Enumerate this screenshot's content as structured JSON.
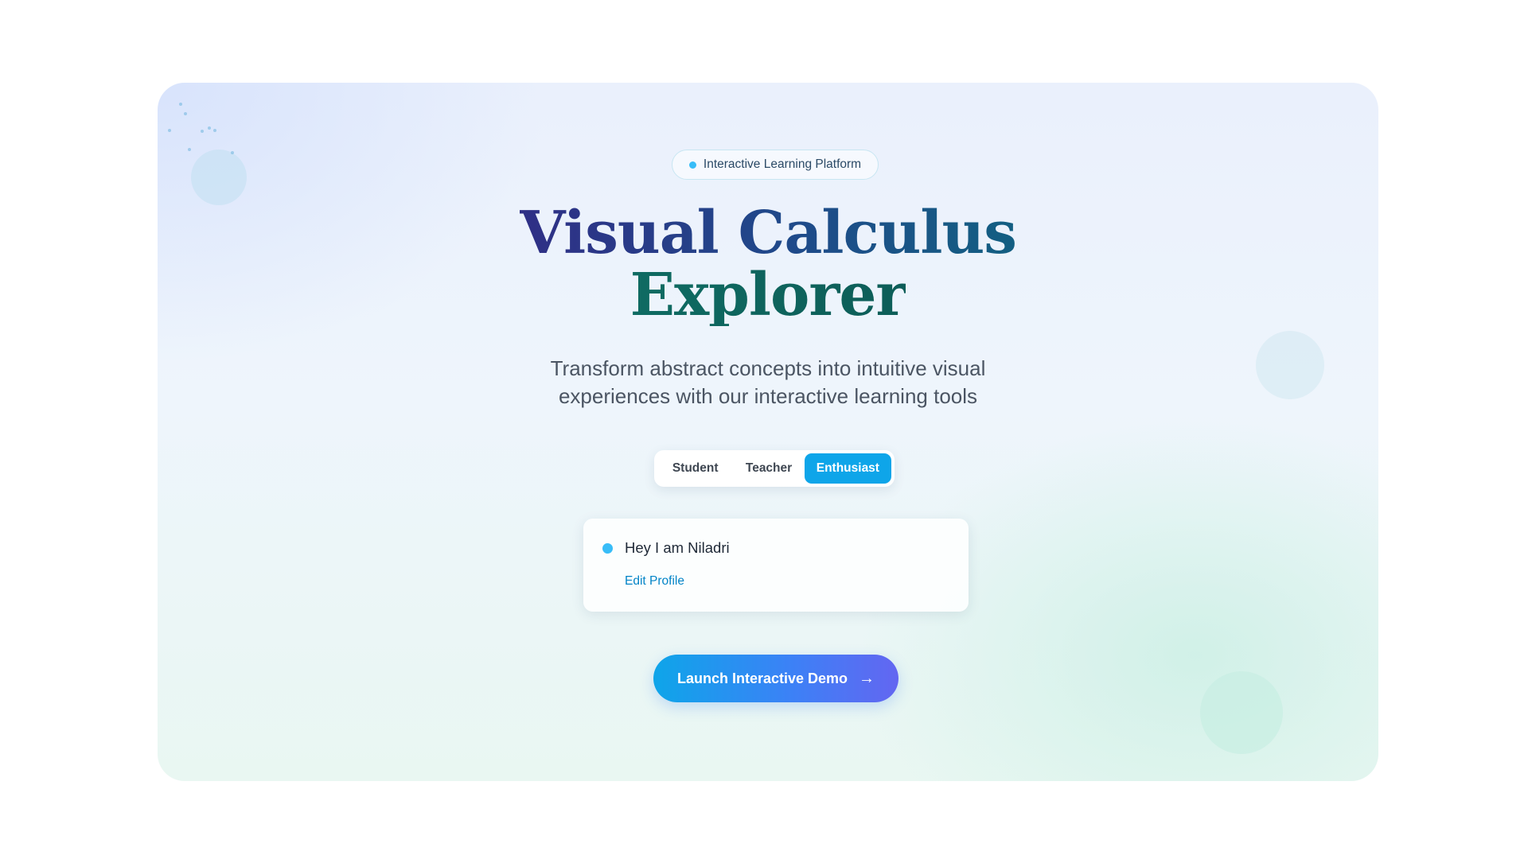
{
  "badge": {
    "label": "Interactive Learning Platform",
    "icon": "status-dot"
  },
  "hero": {
    "title_line1": "Visual Calculus",
    "title_line2": "Explorer",
    "subtitle_line1": "Transform abstract concepts into intuitive visual",
    "subtitle_line2": "experiences with our interactive learning tools"
  },
  "roles": {
    "options": [
      "Student",
      "Teacher",
      "Enthusiast"
    ],
    "selected": "Enthusiast"
  },
  "profile": {
    "greeting": "Hey I am Niladri",
    "edit_label": "Edit Profile"
  },
  "cta": {
    "label": "Launch Interactive Demo",
    "arrow": "→"
  },
  "colors": {
    "accent": "#0ea5e9",
    "cta_gradient_start": "#0ea5e9",
    "cta_gradient_end": "#6366f1",
    "title_primary": "#2f2f86",
    "title_secondary": "#0f6b62",
    "link": "#0284c7"
  }
}
